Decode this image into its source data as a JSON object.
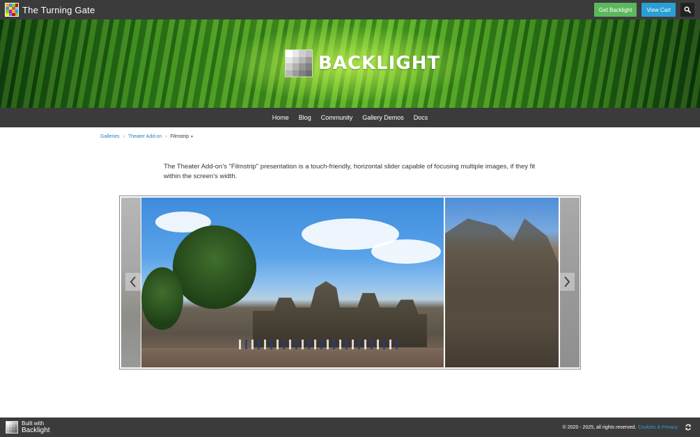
{
  "header": {
    "site_title": "The Turning Gate",
    "get_backlight_label": "Get Backlight",
    "view_cart_label": "View Cart",
    "search_icon": "search-icon"
  },
  "banner": {
    "wordmark": "BACKLIGHT",
    "logo_icon": "backlight-logo"
  },
  "nav": {
    "items": [
      {
        "label": "Home"
      },
      {
        "label": "Blog"
      },
      {
        "label": "Community"
      },
      {
        "label": "Gallery Demos"
      },
      {
        "label": "Docs"
      }
    ]
  },
  "breadcrumb": {
    "items": [
      "Galleries",
      "Theater Add-on"
    ],
    "current": "Filmstrip"
  },
  "intro": {
    "text": "The Theater Add-on's \"Filmstrip\" presentation is a touch-friendly, horizontal slider capable of focusing multiple images, if they fit within the screen's width."
  },
  "filmstrip": {
    "prev_icon": "chevron-left-icon",
    "next_icon": "chevron-right-icon"
  },
  "footer": {
    "built_line1": "Built with",
    "built_line2": "Backlight",
    "copyright": "© 2020 - 2025, all rights reserved.",
    "cookies_link": "Cookies & Privacy",
    "refresh_icon": "refresh-icon"
  },
  "colors": {
    "bar": "#3b3b3b",
    "green_button": "#5cb85c",
    "blue_button": "#2a9fd6",
    "link": "#2a7fc1"
  }
}
